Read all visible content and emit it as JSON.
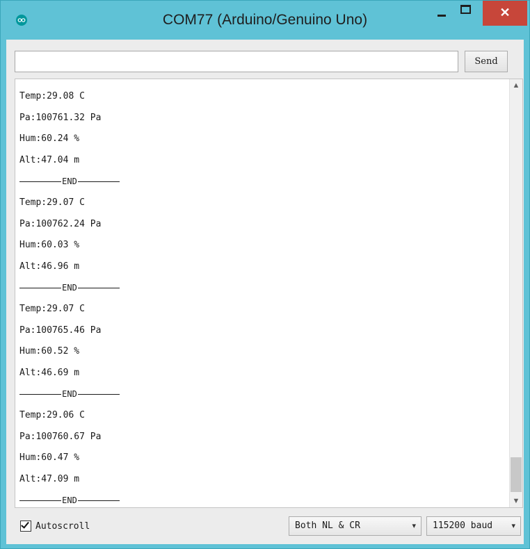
{
  "window": {
    "title": "COM77 (Arduino/Genuino Uno)",
    "close_symbol": "✕",
    "colors": {
      "titlebar": "#5fc2d6",
      "close": "#c7463a",
      "app_icon": "#00979c"
    }
  },
  "icons": {
    "app": "arduino-logo-icon",
    "minimize": "minimize-icon",
    "maximize": "maximize-icon",
    "close": "close-icon",
    "scroll_up": "chevron-up-icon",
    "scroll_down": "chevron-down-icon",
    "dropdown": "chevron-down-icon"
  },
  "send": {
    "input_value": "",
    "button_label": "Send"
  },
  "output": {
    "lines": [
      "Temp:29.08 C",
      "Pa:100761.32 Pa",
      "Hum:60.24 %",
      "Alt:47.04 m",
      "END",
      "Temp:29.07 C",
      "Pa:100762.24 Pa",
      "Hum:60.03 %",
      "Alt:46.96 m",
      "END",
      "Temp:29.07 C",
      "Pa:100765.46 Pa",
      "Hum:60.52 %",
      "Alt:46.69 m",
      "END",
      "Temp:29.06 C",
      "Pa:100760.67 Pa",
      "Hum:60.47 %",
      "Alt:47.09 m",
      "END"
    ]
  },
  "status": {
    "autoscroll_label": "Autoscroll",
    "autoscroll_checked": true,
    "line_ending": "Both NL & CR",
    "baud": "115200 baud"
  }
}
